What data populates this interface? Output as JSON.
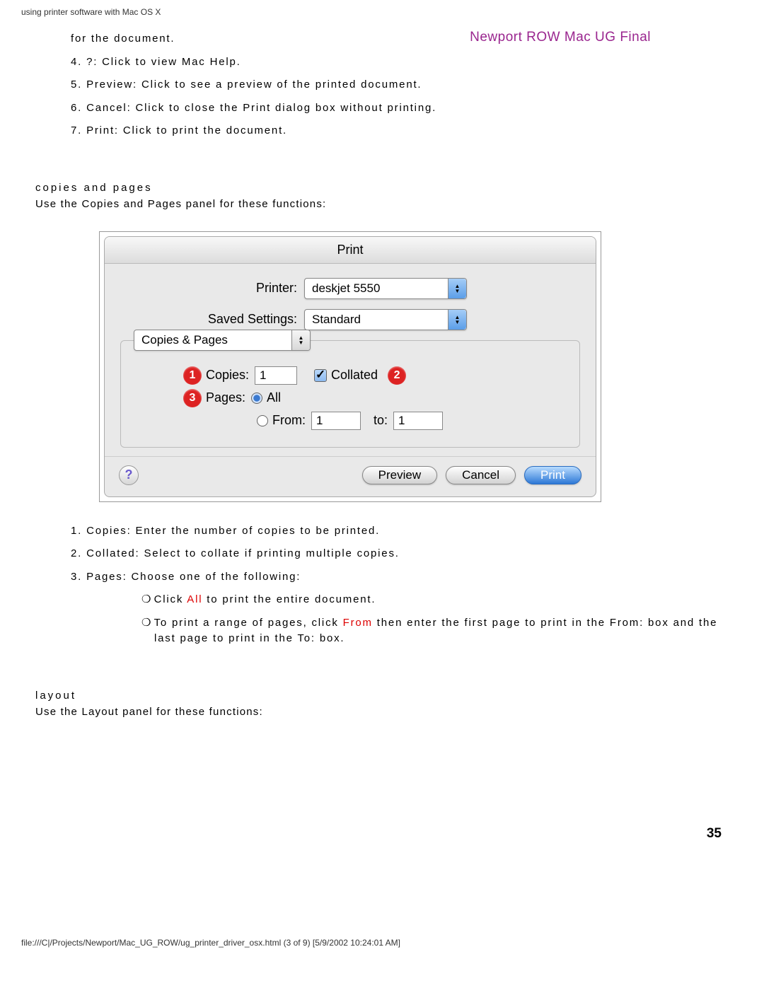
{
  "header": "using printer software with Mac OS X",
  "watermark": "Newport ROW Mac UG Final",
  "intro_tail": "for the document.",
  "items": {
    "i4": "4. ?: Click to view Mac Help.",
    "i5": "5. Preview: Click to see a preview of the printed document.",
    "i6": "6. Cancel: Click to close the Print dialog box without printing.",
    "i7": "7. Print: Click to print the document."
  },
  "section1": {
    "title": "copies and pages",
    "intro": "Use the Copies and Pages panel for these functions:"
  },
  "dialog": {
    "title": "Print",
    "printer_label": "Printer:",
    "printer_value": "deskjet 5550",
    "saved_label": "Saved Settings:",
    "saved_value": "Standard",
    "panel_value": "Copies & Pages",
    "copies_label": "Copies:",
    "copies_value": "1",
    "collated_label": "Collated",
    "pages_label": "Pages:",
    "all_label": "All",
    "from_label": "From:",
    "from_value": "1",
    "to_label": "to:",
    "to_value": "1",
    "preview_btn": "Preview",
    "cancel_btn": "Cancel",
    "print_btn": "Print",
    "callouts": {
      "c1": "1",
      "c2": "2",
      "c3": "3"
    }
  },
  "below": {
    "b1": "1. Copies: Enter the number of copies to be printed.",
    "b2": "2. Collated: Select to collate if printing multiple copies.",
    "b3": "3. Pages: Choose one of the following:",
    "s1a": "Click ",
    "s1b": "All",
    "s1c": " to print the entire document.",
    "s2a": "To print a range of pages, click ",
    "s2b": "From",
    "s2c": " then enter the first page to print in the From: box and the last page to print in the To: box."
  },
  "section2": {
    "title": "layout",
    "intro": "Use the Layout panel for these functions:"
  },
  "page_num": "35",
  "footer": "file:///C|/Projects/Newport/Mac_UG_ROW/ug_printer_driver_osx.html (3 of 9) [5/9/2002 10:24:01 AM]"
}
